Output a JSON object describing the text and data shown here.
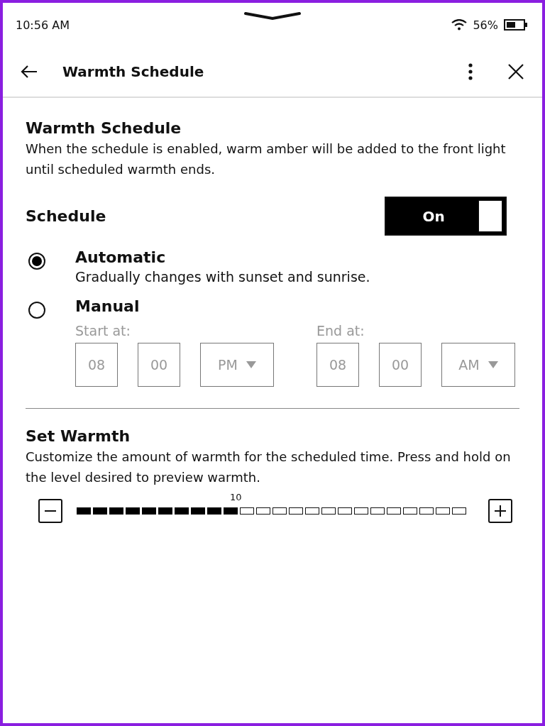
{
  "status_bar": {
    "time": "10:56 AM",
    "battery_percent": "56%"
  },
  "header": {
    "title": "Warmth Schedule"
  },
  "intro": {
    "title": "Warmth Schedule",
    "description": "When the schedule is enabled, warm amber will be added to the front light until scheduled warmth ends."
  },
  "schedule": {
    "label": "Schedule",
    "toggle": {
      "label": "On",
      "on": true
    }
  },
  "modes": [
    {
      "label": "Automatic",
      "description": "Gradually changes with sunset and sunrise.",
      "selected": true
    },
    {
      "label": "Manual",
      "selected": false
    }
  ],
  "manual_times": {
    "disabled": true,
    "groups": [
      {
        "label": "Start at:",
        "hour": "08",
        "minute": "00",
        "period": "PM"
      },
      {
        "label": "End at:",
        "hour": "08",
        "minute": "00",
        "period": "AM"
      }
    ]
  },
  "warmth": {
    "title": "Set Warmth",
    "description": "Customize the amount of warmth for the scheduled time. Press and hold on the level desired to preview warmth.",
    "value_label": "10",
    "level": 0.4167
  }
}
